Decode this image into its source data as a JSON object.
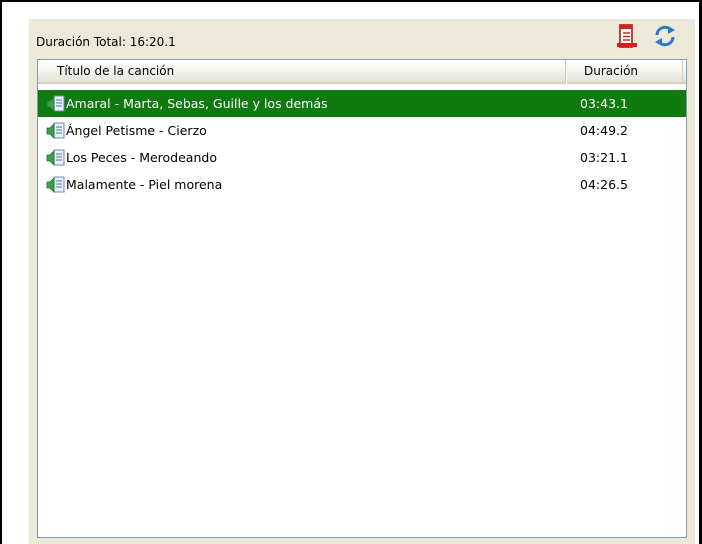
{
  "header": {
    "total_label": "Duración Total: 16:20.1"
  },
  "toolbar": {
    "list_icon": "playlist-icon",
    "refresh_icon": "refresh-icon"
  },
  "columns": {
    "title": "Título de la canción",
    "duration": "Duración"
  },
  "rows": [
    {
      "title": "Amaral - Marta, Sebas, Guille y los demás",
      "duration": "03:43.1",
      "selected": true
    },
    {
      "title": "Ángel Petisme - Cierzo",
      "duration": "04:49.2",
      "selected": false
    },
    {
      "title": "Los Peces - Merodeando",
      "duration": "03:21.1",
      "selected": false
    },
    {
      "title": "Malamente - Piel morena",
      "duration": "04:26.5",
      "selected": false
    }
  ],
  "colors": {
    "selection": "#0f7a10",
    "panel": "#ece9d8",
    "list_border": "#7f9db9"
  }
}
